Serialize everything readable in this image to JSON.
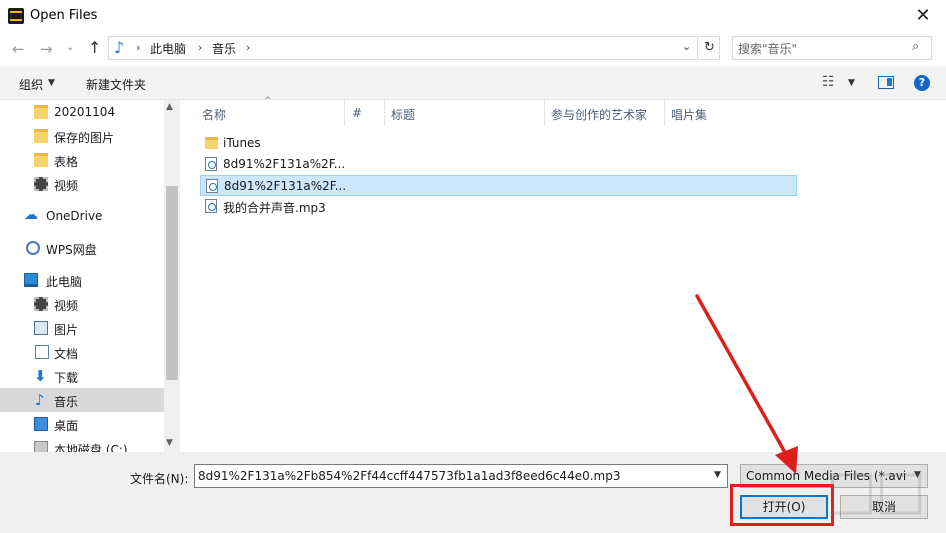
{
  "window": {
    "title": "Open Files",
    "close_glyph": "✕"
  },
  "address": {
    "back_glyph": "←",
    "forward_glyph": "→",
    "recent_glyph": "⌄",
    "up_glyph": "↑",
    "crumbs": [
      "此电脑",
      "音乐"
    ],
    "search_placeholder": "搜索\"音乐\"",
    "search_icon": "search-icon",
    "refresh_glyph": "↻"
  },
  "toolbar": {
    "organize": "组织",
    "new_folder": "新建文件夹",
    "help_glyph": "?"
  },
  "sidebar": {
    "items": [
      {
        "label": "20201104",
        "icon": "folder-icon"
      },
      {
        "label": "保存的图片",
        "icon": "folder-icon"
      },
      {
        "label": "表格",
        "icon": "folder-icon"
      },
      {
        "label": "视频",
        "icon": "video-icon"
      },
      {
        "label": "OneDrive",
        "icon": "cloud-icon"
      },
      {
        "label": "WPS网盘",
        "icon": "wps-cloud-icon"
      },
      {
        "label": "此电脑",
        "icon": "computer-icon"
      },
      {
        "label": "视频",
        "icon": "video-icon"
      },
      {
        "label": "图片",
        "icon": "picture-icon"
      },
      {
        "label": "文档",
        "icon": "document-icon"
      },
      {
        "label": "下载",
        "icon": "download-icon"
      },
      {
        "label": "音乐",
        "icon": "music-icon",
        "selected": true
      },
      {
        "label": "桌面",
        "icon": "desktop-icon"
      },
      {
        "label": "本地磁盘 (C:)",
        "icon": "disk-icon"
      }
    ]
  },
  "filelist": {
    "columns": [
      "名称",
      "#",
      "标题",
      "参与创作的艺术家",
      "唱片集"
    ],
    "files": [
      {
        "name": "iTunes",
        "type": "folder"
      },
      {
        "name": "8d91%2F131a%2F...",
        "type": "audio"
      },
      {
        "name": "8d91%2F131a%2F...",
        "type": "audio",
        "selected": true
      },
      {
        "name": "我的合并声音.mp3",
        "type": "audio"
      }
    ]
  },
  "bottom": {
    "filename_label": "文件名(N):",
    "filename_value": "8d91%2F131a%2Fb854%2Ff44ccff447573fb1a1ad3f8eed6c44e0.mp3",
    "filetype_value": "Common Media Files (*.avi;*",
    "open_button": "打开(O)",
    "cancel_button": "取消"
  },
  "colors": {
    "accent": "#0078d7",
    "annotation": "#e01e1e",
    "selection": "#cce8ff"
  }
}
